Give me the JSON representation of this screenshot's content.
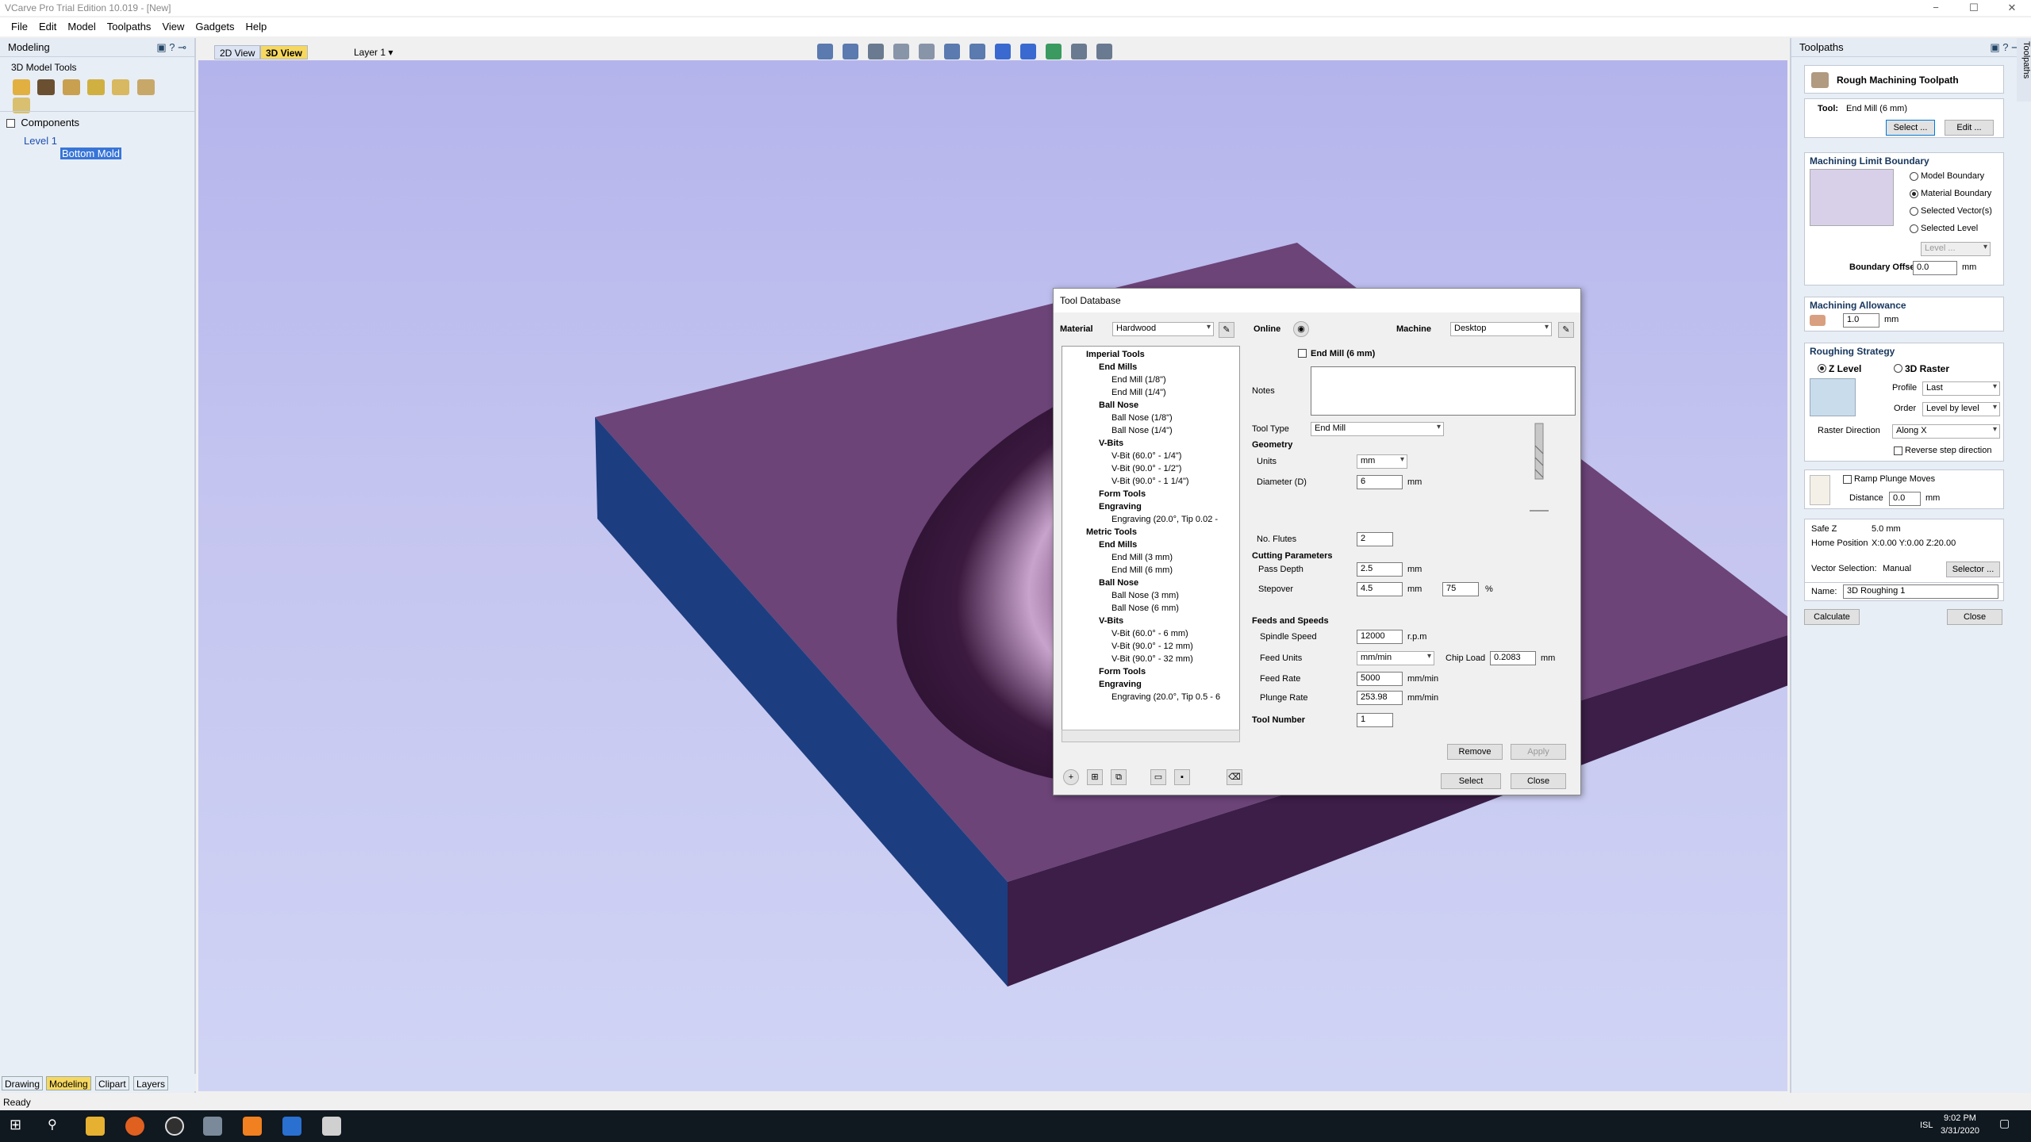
{
  "window": {
    "title": "VCarve Pro Trial Edition 10.019 - [New]",
    "minimize": "−",
    "maximize": "☐",
    "close": "✕"
  },
  "menu": [
    "File",
    "Edit",
    "Model",
    "Toolpaths",
    "View",
    "Gadgets",
    "Help"
  ],
  "left": {
    "panel_title": "Modeling",
    "tools_title": "3D Model Tools",
    "components_label": "Components",
    "level": "Level 1",
    "component": "Bottom Mold"
  },
  "viewtabs": {
    "tab2d": "2D View",
    "tab3d": "3D View",
    "layer": "Layer 1"
  },
  "bottom_tabs": [
    "Drawing",
    "Modeling",
    "Clipart",
    "Layers"
  ],
  "status": "Ready",
  "right": {
    "panel_title": "Toolpaths",
    "side_tab": "Toolpaths",
    "header": "Rough Machining Toolpath",
    "tool_label": "Tool:",
    "tool_value": "End Mill (6 mm)",
    "select_btn": "Select ...",
    "edit_btn": "Edit ...",
    "boundary_title": "Machining Limit Boundary",
    "b_model": "Model Boundary",
    "b_material": "Material Boundary",
    "b_vectors": "Selected Vector(s)",
    "b_level": "Selected Level",
    "level_combo": "Level ...",
    "boundary_offset_label": "Boundary Offset",
    "boundary_offset": "0.0",
    "mm": "mm",
    "allowance_title": "Machining Allowance",
    "allowance": "1.0",
    "roughing_title": "Roughing Strategy",
    "zlevel": "Z Level",
    "raster3d": "3D Raster",
    "profile_label": "Profile",
    "profile": "Last",
    "order_label": "Order",
    "order": "Level by level",
    "raster_dir_label": "Raster Direction",
    "raster_dir": "Along X",
    "reverse": "Reverse step direction",
    "ramp": "Ramp Plunge Moves",
    "distance_label": "Distance",
    "distance": "0.0",
    "safez_label": "Safe Z",
    "safez": "5.0 mm",
    "home_label": "Home Position",
    "home": "X:0.00 Y:0.00 Z:20.00",
    "vecsel_label": "Vector Selection:",
    "vecsel": "Manual",
    "selector_btn": "Selector ...",
    "name_label": "Name:",
    "name": "3D Roughing 1",
    "calc_btn": "Calculate",
    "close_btn": "Close"
  },
  "dialog": {
    "title": "Tool Database",
    "material_label": "Material",
    "material": "Hardwood",
    "online_label": "Online",
    "machine_label": "Machine",
    "machine": "Desktop",
    "tool_name": "End Mill (6 mm)",
    "notes_label": "Notes",
    "tooltype_label": "Tool Type",
    "tooltype": "End Mill",
    "geometry": "Geometry",
    "units_label": "Units",
    "units": "mm",
    "diameter_label": "Diameter (D)",
    "diameter": "6",
    "mm": "mm",
    "flutes_label": "No. Flutes",
    "flutes": "2",
    "cutting": "Cutting Parameters",
    "passdepth_label": "Pass Depth",
    "passdepth": "2.5",
    "stepover_label": "Stepover",
    "stepover": "4.5",
    "stepover_pct": "75",
    "pct": "%",
    "feeds": "Feeds and Speeds",
    "spindle_label": "Spindle Speed",
    "spindle": "12000",
    "rpm": "r.p.m",
    "feedunits_label": "Feed Units",
    "feedunits": "mm/min",
    "chipload_label": "Chip Load",
    "chipload": "0.2083",
    "feedrate_label": "Feed Rate",
    "feedrate": "5000",
    "mmmin": "mm/min",
    "plunge_label": "Plunge Rate",
    "plunge": "253.98",
    "toolnum_label": "Tool Number",
    "toolnum": "1",
    "remove_btn": "Remove",
    "apply_btn": "Apply",
    "select_btn": "Select",
    "close_btn": "Close",
    "tree": [
      {
        "t": "Imperial Tools",
        "lvl": 0,
        "b": true
      },
      {
        "t": "End Mills",
        "lvl": 1,
        "b": true
      },
      {
        "t": "End Mill (1/8\")",
        "lvl": 2
      },
      {
        "t": "End Mill (1/4\")",
        "lvl": 2
      },
      {
        "t": "Ball Nose",
        "lvl": 1,
        "b": true
      },
      {
        "t": "Ball Nose (1/8\")",
        "lvl": 2
      },
      {
        "t": "Ball Nose (1/4\")",
        "lvl": 2
      },
      {
        "t": "V-Bits",
        "lvl": 1,
        "b": true
      },
      {
        "t": "V-Bit (60.0° - 1/4\")",
        "lvl": 2
      },
      {
        "t": "V-Bit (90.0° - 1/2\")",
        "lvl": 2
      },
      {
        "t": "V-Bit (90.0° - 1 1/4\")",
        "lvl": 2
      },
      {
        "t": "Form Tools",
        "lvl": 1,
        "b": true
      },
      {
        "t": "Engraving",
        "lvl": 1,
        "b": true
      },
      {
        "t": "Engraving (20.0°, Tip 0.02 -",
        "lvl": 2
      },
      {
        "t": "Metric Tools",
        "lvl": 0,
        "b": true
      },
      {
        "t": "End Mills",
        "lvl": 1,
        "b": true
      },
      {
        "t": "End Mill (3 mm)",
        "lvl": 2
      },
      {
        "t": "End Mill (6 mm)",
        "lvl": 2
      },
      {
        "t": "Ball Nose",
        "lvl": 1,
        "b": true
      },
      {
        "t": "Ball Nose (3 mm)",
        "lvl": 2
      },
      {
        "t": "Ball Nose (6 mm)",
        "lvl": 2
      },
      {
        "t": "V-Bits",
        "lvl": 1,
        "b": true
      },
      {
        "t": "V-Bit (60.0° - 6 mm)",
        "lvl": 2
      },
      {
        "t": "V-Bit (90.0° - 12 mm)",
        "lvl": 2
      },
      {
        "t": "V-Bit (90.0° - 32 mm)",
        "lvl": 2
      },
      {
        "t": "Form Tools",
        "lvl": 1,
        "b": true
      },
      {
        "t": "Engraving",
        "lvl": 1,
        "b": true
      },
      {
        "t": "Engraving (20.0°, Tip 0.5 - 6",
        "lvl": 2
      }
    ]
  },
  "taskbar": {
    "time": "9:02 PM",
    "date": "3/31/2020",
    "lang": "ISL"
  }
}
